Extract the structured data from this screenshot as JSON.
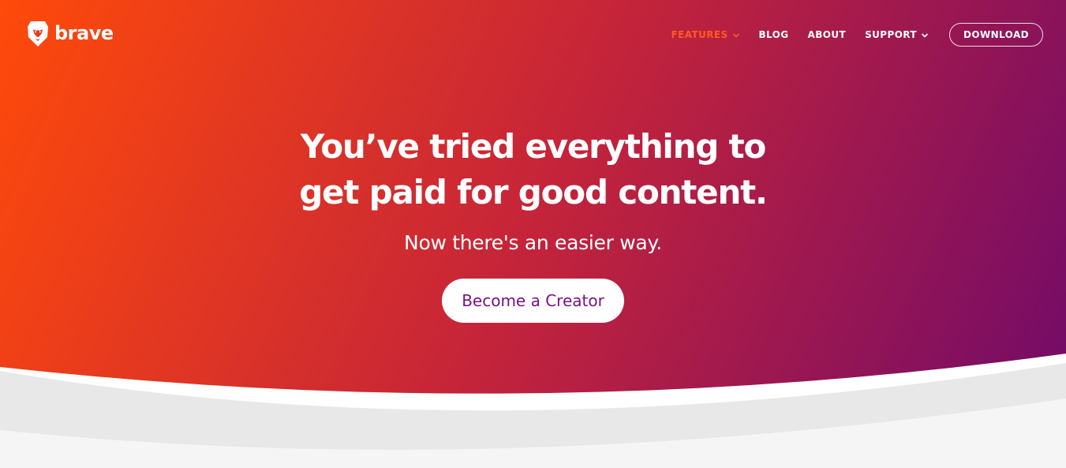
{
  "brand": {
    "name": "brave",
    "logo_icon": "lion-icon"
  },
  "nav": {
    "items": [
      {
        "label": "FEATURES",
        "has_dropdown": true,
        "active": true
      },
      {
        "label": "BLOG",
        "has_dropdown": false,
        "active": false
      },
      {
        "label": "ABOUT",
        "has_dropdown": false,
        "active": false
      },
      {
        "label": "SUPPORT",
        "has_dropdown": true,
        "active": false
      }
    ],
    "download_label": "DOWNLOAD"
  },
  "hero": {
    "headline_line1": "You’ve tried everything to",
    "headline_line2": "get paid for good content.",
    "subheadline": "Now there's an easier way.",
    "cta_label": "Become a Creator"
  },
  "colors": {
    "gradient_start": "#ff4a0a",
    "gradient_mid": "#c4243a",
    "gradient_end": "#6f0a6a",
    "active_nav": "#ff5a1e",
    "cta_text": "#7a1282",
    "wave_light_grey": "#e8e8e8",
    "wave_lighter_grey": "#f5f5f5",
    "background": "#ffffff"
  }
}
